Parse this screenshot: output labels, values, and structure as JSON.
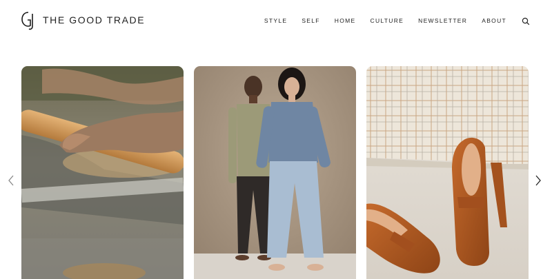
{
  "brand": {
    "name": "THE GOOD TRADE"
  },
  "nav": {
    "items": [
      {
        "label": "STYLE"
      },
      {
        "label": "SELF"
      },
      {
        "label": "HOME"
      },
      {
        "label": "CULTURE"
      },
      {
        "label": "NEWSLETTER"
      },
      {
        "label": "ABOUT"
      }
    ],
    "search_icon": "search-icon"
  },
  "carousel": {
    "prev_icon": "chevron-left-icon",
    "next_icon": "chevron-right-icon",
    "slides": [
      {
        "image": "hands-rolling-dough-photo"
      },
      {
        "image": "two-women-standing-photo"
      },
      {
        "image": "suede-loafers-photo"
      }
    ]
  },
  "colors": {
    "text": "#222222",
    "background": "#ffffff"
  }
}
